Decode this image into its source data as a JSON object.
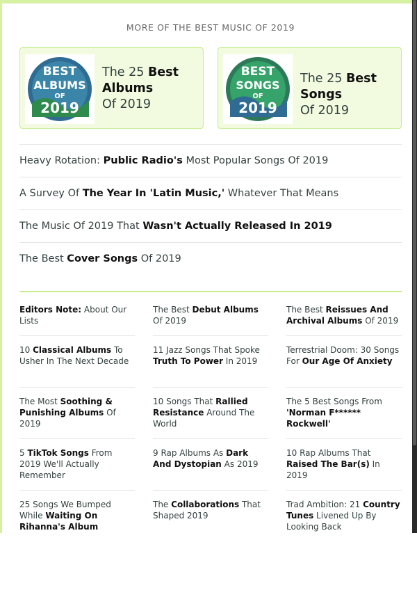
{
  "header": "MORE OF THE BEST MUSIC OF 2019",
  "cards": [
    {
      "badge_lines": [
        "BEST",
        "ALBUMS",
        "OF",
        "2019"
      ],
      "title_pre": "The 25 ",
      "title_bold": "Best Albums",
      "title_post": "Of 2019"
    },
    {
      "badge_lines": [
        "BEST",
        "SONGS",
        "OF",
        "2019"
      ],
      "title_pre": "The 25 ",
      "title_bold": "Best Songs",
      "title_post": "Of 2019"
    }
  ],
  "links": [
    {
      "pre": "Heavy Rotation: ",
      "bold": "Public Radio's",
      "post": " Most Popular Songs Of 2019"
    },
    {
      "pre": "A Survey Of ",
      "bold": "The Year In 'Latin Music,'",
      "post": " Whatever That Means"
    },
    {
      "pre": "The Music Of 2019 That ",
      "bold": "Wasn't Actually Released In 2019",
      "post": ""
    },
    {
      "pre": "The Best ",
      "bold": "Cover Songs",
      "post": " Of 2019"
    }
  ],
  "grid": {
    "col1": [
      {
        "pre": "",
        "bold": "Editors Note:",
        "post": " About Our Lists"
      },
      {
        "pre": "10 ",
        "bold": "Classical Albums",
        "post": " To Usher In The Next Decade"
      },
      {
        "pre": "The Most ",
        "bold": "Soothing & Punishing Albums",
        "post": " Of 2019"
      },
      {
        "pre": "5 ",
        "bold": "TikTok Songs",
        "post": " From 2019 We'll Actually Remember"
      },
      {
        "pre": "25 Songs We Bumped While ",
        "bold": "Waiting On Rihanna's Album",
        "post": ""
      }
    ],
    "col2": [
      {
        "pre": "The Best ",
        "bold": "Debut Albums",
        "post": " Of 2019"
      },
      {
        "pre": "11 Jazz Songs That Spoke ",
        "bold": "Truth To Power",
        "post": " In 2019"
      },
      {
        "pre": "10 Songs That ",
        "bold": "Rallied Resistance",
        "post": " Around The World"
      },
      {
        "pre": "9 Rap Albums As ",
        "bold": "Dark And Dystopian",
        "post": " As 2019"
      },
      {
        "pre": "The ",
        "bold": "Collaborations",
        "post": " That Shaped 2019"
      }
    ],
    "col3": [
      {
        "pre": "The Best ",
        "bold": "Reissues And Archival Albums",
        "post": " Of 2019"
      },
      {
        "pre": "Terrestrial Doom: 30 Songs For ",
        "bold": "Our Age Of Anxiety",
        "post": ""
      },
      {
        "pre": "The 5 Best Songs From ",
        "bold": "'Norman F****** Rockwell'",
        "post": ""
      },
      {
        "pre": "10 Rap Albums That ",
        "bold": "Raised The Bar(s)",
        "post": " In 2019"
      },
      {
        "pre": "Trad Ambition: 21 ",
        "bold": "Country Tunes",
        "post": " Livened Up By Looking Back"
      }
    ]
  },
  "colors": {
    "accent": "#c7ec8e",
    "card_bg": "#f2fbdf",
    "badge_blue": "#2d6f9a",
    "badge_green": "#2e8a4d"
  }
}
